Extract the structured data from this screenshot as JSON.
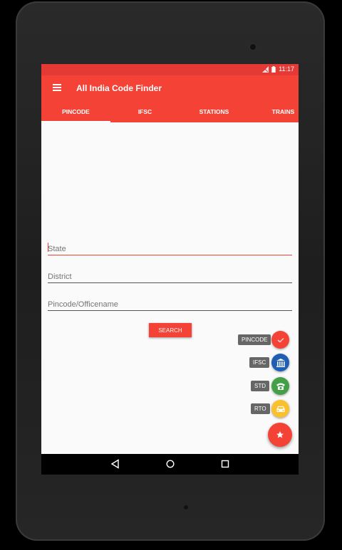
{
  "statusbar": {
    "time": "11:17"
  },
  "appbar": {
    "title": "All India Code Finder"
  },
  "tabs": [
    {
      "label": "PINCODE",
      "active": true
    },
    {
      "label": "IFSC",
      "active": false
    },
    {
      "label": "STATIONS",
      "active": false
    },
    {
      "label": "TRAINS",
      "active": false
    }
  ],
  "form": {
    "state_placeholder": "State",
    "district_placeholder": "District",
    "pincode_placeholder": "Pincode/Officename",
    "search_label": "SEARCH"
  },
  "fab_menu": [
    {
      "label": "PINCODE",
      "icon": "check-icon",
      "color": "#f44336"
    },
    {
      "label": "IFSC",
      "icon": "bank-icon",
      "color": "#1e5fb4"
    },
    {
      "label": "STD",
      "icon": "phone-icon",
      "color": "#43a047"
    },
    {
      "label": "RTO",
      "icon": "car-icon",
      "color": "#fbc02d"
    }
  ],
  "fab_main": {
    "icon": "star-icon",
    "color": "#f44336"
  },
  "colors": {
    "primary": "#f44336",
    "primary_dark": "#e53935"
  }
}
